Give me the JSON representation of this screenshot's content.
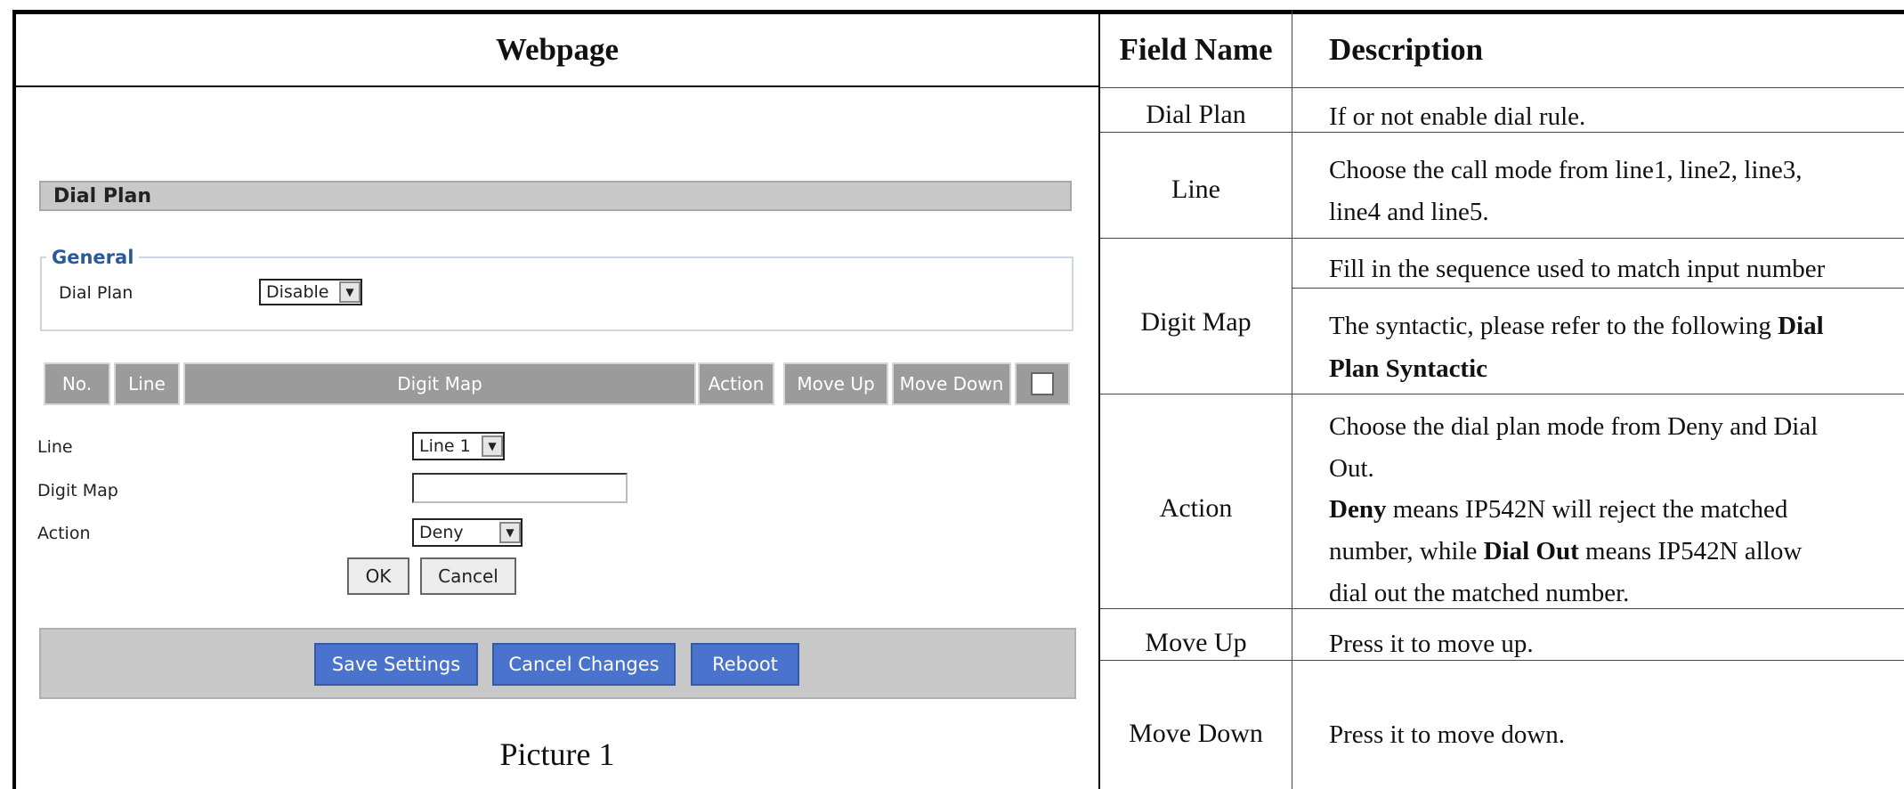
{
  "headers": {
    "webpage": "Webpage",
    "field_name": "Field Name",
    "description": "Description"
  },
  "ui": {
    "section_title": "Dial Plan",
    "group_title": "General",
    "dial_plan_label": "Dial Plan",
    "dial_plan_value": "Disable",
    "table_headers": [
      "No.",
      "Line",
      "Digit Map",
      "Action",
      "Move Up",
      "Move Down"
    ],
    "line_label": "Line",
    "line_value": "Line 1",
    "digit_map_label": "Digit Map",
    "digit_map_value": "",
    "action_label": "Action",
    "action_value": "Deny",
    "ok_label": "OK",
    "cancel_label": "Cancel",
    "save_settings": "Save Settings",
    "cancel_changes": "Cancel Changes",
    "reboot": "Reboot"
  },
  "caption": "Picture 1",
  "rows": {
    "dial_plan": {
      "field": "Dial Plan",
      "desc": "If or not enable dial rule."
    },
    "line": {
      "field": "Line",
      "desc1": "Choose the call mode from line1, line2, line3,",
      "desc2": "line4 and line5."
    },
    "digit_map": {
      "field": "Digit Map",
      "desc1": "Fill in the sequence used to match input number",
      "desc2a": "The syntactic, please refer to the following ",
      "desc2b": "Dial",
      "desc3": "Plan Syntactic"
    },
    "action": {
      "field": "Action",
      "l1": "Choose the dial plan mode from Deny and Dial",
      "l2": "Out.",
      "l3b": "Deny",
      "l3": " means IP542N will reject the matched",
      "l4a": "number, while ",
      "l4b": "Dial Out",
      "l4c": " means IP542N allow",
      "l5": "dial out the matched number."
    },
    "move_up": {
      "field": "Move Up",
      "desc": "Press it to move up."
    },
    "move_down": {
      "field": "Move Down",
      "desc": "Press it to move down."
    }
  }
}
